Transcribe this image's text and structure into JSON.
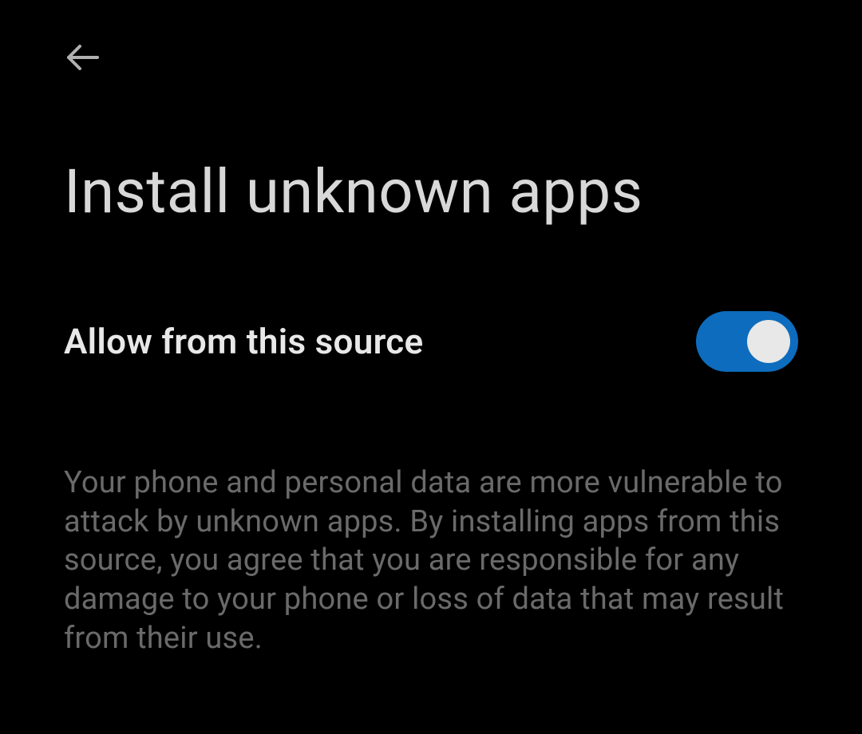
{
  "header": {
    "page_title": "Install unknown apps"
  },
  "setting": {
    "label": "Allow from this source",
    "enabled": true
  },
  "description": "Your phone and personal data are more vulnerable to attack by unknown apps. By installing apps from this source, you agree that you are responsible for any damage to your phone or loss of data that may result from their use."
}
